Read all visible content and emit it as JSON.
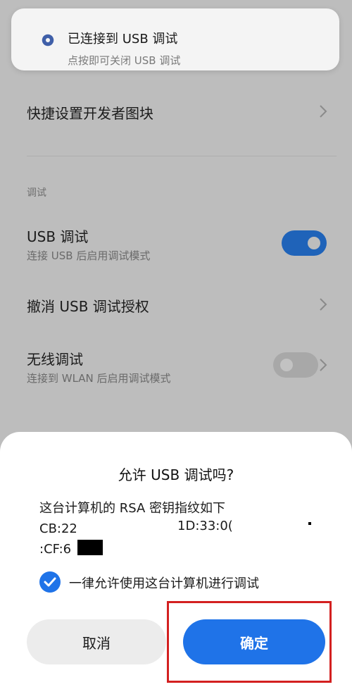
{
  "notification": {
    "icon": "gear-icon",
    "title": "已连接到 USB 调试",
    "subtitle": "点按即可关闭 USB 调试"
  },
  "settings": {
    "quick_tiles": {
      "title": "快捷设置开发者图块"
    },
    "section_label": "调试",
    "usb_debugging": {
      "title": "USB 调试",
      "subtitle": "连接 USB 后启用调试模式",
      "enabled": true
    },
    "revoke_auth": {
      "title": "撤消 USB 调试授权"
    },
    "wireless_debugging": {
      "title": "无线调试",
      "subtitle": "连接到 WLAN 后启用调试模式",
      "enabled": false
    }
  },
  "dialog": {
    "title": "允许 USB 调试吗?",
    "fingerprint_lines": [
      "这台计算机的 RSA 密钥指纹如下",
      "CB:22",
      ":CF:6"
    ],
    "fingerprint_fragment": "1D:33:0(",
    "always_allow_label": "一律允许使用这台计算机进行调试",
    "always_allow_checked": true,
    "cancel_label": "取消",
    "ok_label": "确定"
  },
  "colors": {
    "accent": "#1f73e8",
    "toggle_on": "#1f63b9",
    "highlight_box": "#d32020"
  }
}
